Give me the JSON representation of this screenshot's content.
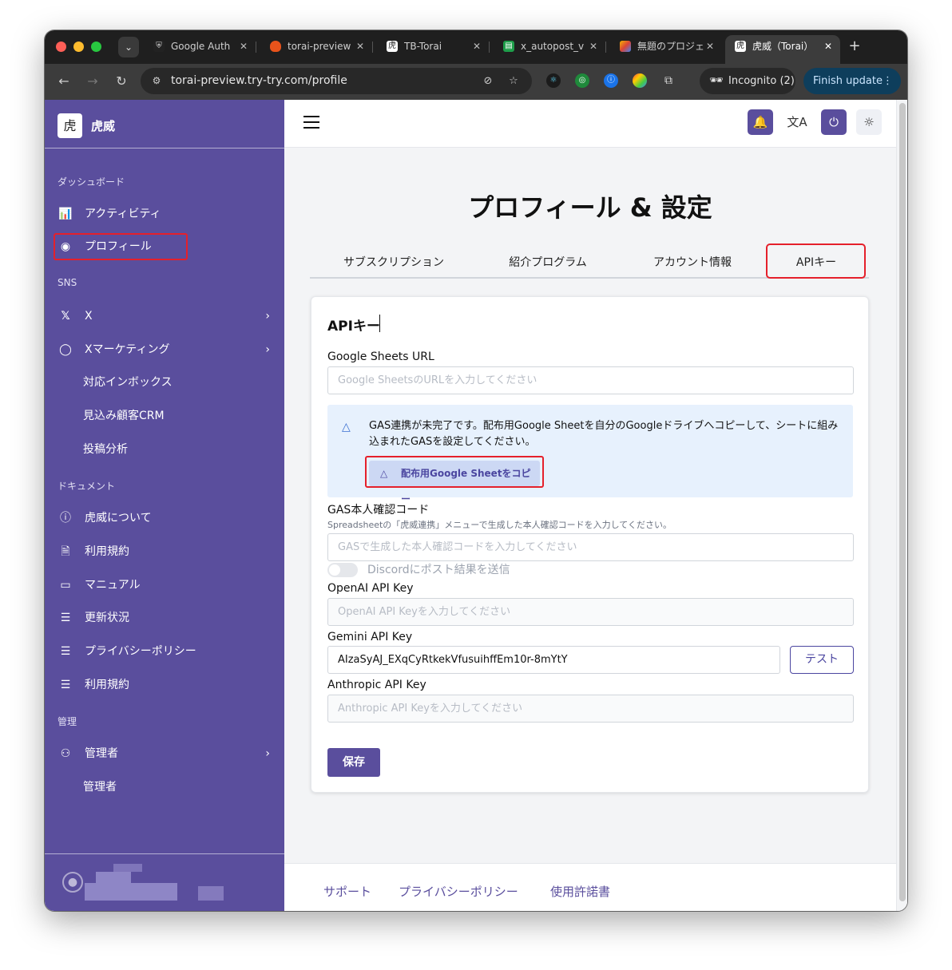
{
  "browser": {
    "tabs": [
      {
        "label": "Google Auth",
        "icon": "shield-icon"
      },
      {
        "label": "torai-preview",
        "icon": "flame-icon"
      },
      {
        "label": "TB-Torai",
        "icon": "tiger-logo-icon"
      },
      {
        "label": "x_autopost_v",
        "icon": "sheet-icon"
      },
      {
        "label": "無題のプロジェ",
        "icon": "pinwheel-icon"
      },
      {
        "label": "虎威（Torai）",
        "icon": "tiger-logo-icon"
      }
    ],
    "url": "torai-preview.try-try.com/profile",
    "incognito_label": "Incognito (2)",
    "finish_update_label": "Finish update"
  },
  "sidebar": {
    "brand": "虎威",
    "sections": {
      "dashboard": "ダッシュボード",
      "sns": "SNS",
      "docs": "ドキュメント",
      "admin": "管理"
    },
    "items": {
      "activity": "アクティビティ",
      "profile": "プロフィール",
      "x": "X",
      "x_marketing": "Xマーケティング",
      "inbox": "対応インボックス",
      "crm": "見込み顧客CRM",
      "post_analysis": "投稿分析",
      "about": "虎威について",
      "terms": "利用規約",
      "manual": "マニュアル",
      "updates": "更新状況",
      "privacy": "プライバシーポリシー",
      "terms2": "利用規約",
      "admin": "管理者",
      "admin_sub": "管理者"
    }
  },
  "header": {
    "icons": [
      "bell-icon",
      "translate-icon",
      "power-icon",
      "sun-icon"
    ]
  },
  "page": {
    "title": "プロフィール & 設定",
    "tabs": [
      "サブスクリプション",
      "紹介プログラム",
      "アカウント情報",
      "APIキー"
    ],
    "active_tab": "APIキー"
  },
  "api_card": {
    "title": "APIキー",
    "sheets_url_label": "Google Sheets URL",
    "sheets_url_placeholder": "Google SheetsのURLを入力してください",
    "info_text": "GAS連携が未完了です。配布用Google Sheetを自分のGoogleドライブへコピーして、シートに組み込まれたGASを設定してください。",
    "copy_button": "配布用Google Sheetをコピー",
    "gas_code_label": "GAS本人確認コード",
    "gas_code_help": "Spreadsheetの「虎威連携」メニューで生成した本人確認コードを入力してください。",
    "gas_code_placeholder": "GASで生成した本人確認コードを入力してください",
    "discord_toggle_label": "Discordにポスト結果を送信",
    "openai_label": "OpenAI API Key",
    "openai_placeholder": "OpenAI API Keyを入力してください",
    "gemini_label": "Gemini API Key",
    "gemini_value": "AIzaSyAJ_EXqCyRtkekVfusuihffEm10r-8mYtY",
    "test_button": "テスト",
    "anthropic_label": "Anthropic API Key",
    "anthropic_placeholder": "Anthropic API Keyを入力してください",
    "save_button": "保存"
  },
  "footer": {
    "links": [
      "サポート",
      "プライバシーポリシー",
      "使用許諾書"
    ]
  },
  "colors": {
    "sidebar_bg": "#5a4e9d",
    "accent": "#5a4e9d",
    "highlight": "#e5202b",
    "info_bg": "#e7f1fd"
  }
}
